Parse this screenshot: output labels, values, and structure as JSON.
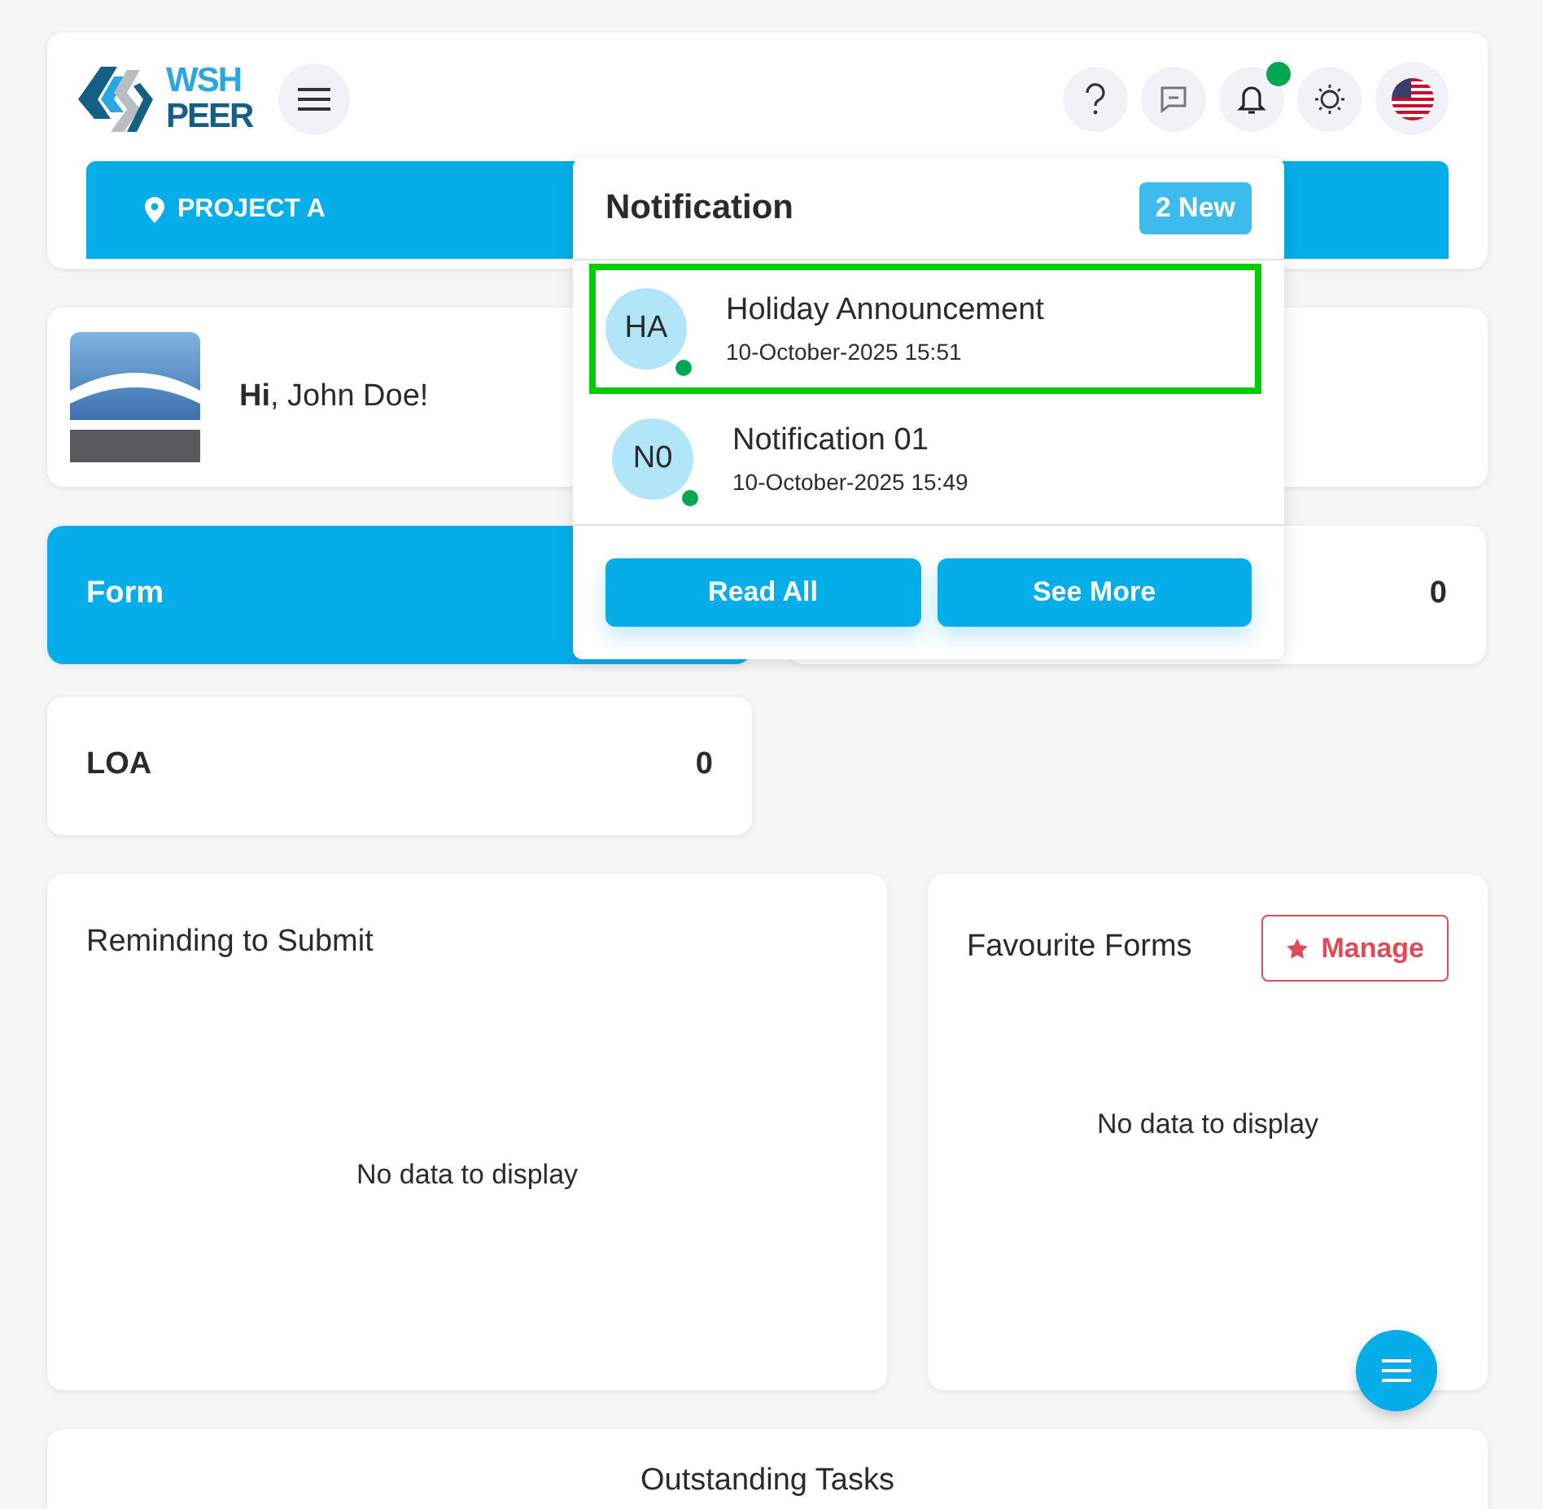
{
  "header": {
    "logo_top": "WSH",
    "logo_bottom": "PEER",
    "project": "PROJECT A",
    "notifications_unread": true
  },
  "greeting": {
    "text": "**Hi**, John Doe!"
  },
  "stats": [
    {
      "label": "Form",
      "active": true
    },
    {
      "value": "0",
      "active": false
    },
    {
      "label": "LOA",
      "value": "0",
      "active": false
    }
  ],
  "reminding": {
    "title": "Reminding to Submit",
    "empty": "No data to display"
  },
  "favourites": {
    "title": "Favourite Forms",
    "button": "Manage",
    "empty": "No data to display"
  },
  "outstanding": {
    "title": "Outstanding Tasks"
  },
  "notification_panel": {
    "title": "Notification",
    "badge": "2 New",
    "items": [
      {
        "initials": "HA",
        "title": "Holiday Announcement",
        "time": "10-October-2025 15:51",
        "unread": true,
        "selected": true
      },
      {
        "initials": "N0",
        "title": "Notification 01",
        "time": "10-October-2025 15:49",
        "unread": true,
        "selected": false
      }
    ],
    "buttons": [
      "Read All",
      "See More"
    ]
  }
}
